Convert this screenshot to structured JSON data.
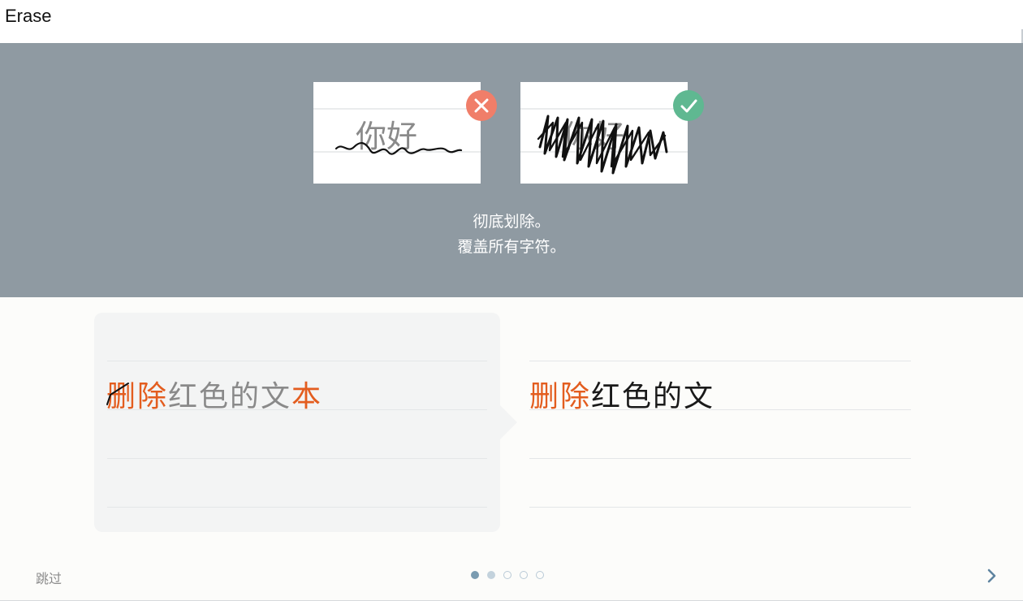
{
  "app": {
    "title": "Erase"
  },
  "banner": {
    "bad_example": {
      "status_icon": "close-icon",
      "sample_text": "你好"
    },
    "good_example": {
      "status_icon": "check-icon",
      "sample_text": "你好"
    },
    "tip_line1": "彻底划除。",
    "tip_line2": "覆盖所有字符。"
  },
  "demo": {
    "before_segments": [
      "删",
      "除",
      "红色的文",
      "本"
    ],
    "after_segments": [
      "删除",
      "红色的文"
    ],
    "highlight_color": "#e35d1f"
  },
  "footer": {
    "skip_label": "跳过",
    "pager": {
      "current": 1,
      "total": 5
    },
    "next_icon": "chevron-right-icon"
  },
  "colors": {
    "banner_bg": "#8f9aa2",
    "error": "#f07e69",
    "success": "#5fb891",
    "accent": "#e35d1f",
    "dot_active": "#7a9bb0"
  }
}
